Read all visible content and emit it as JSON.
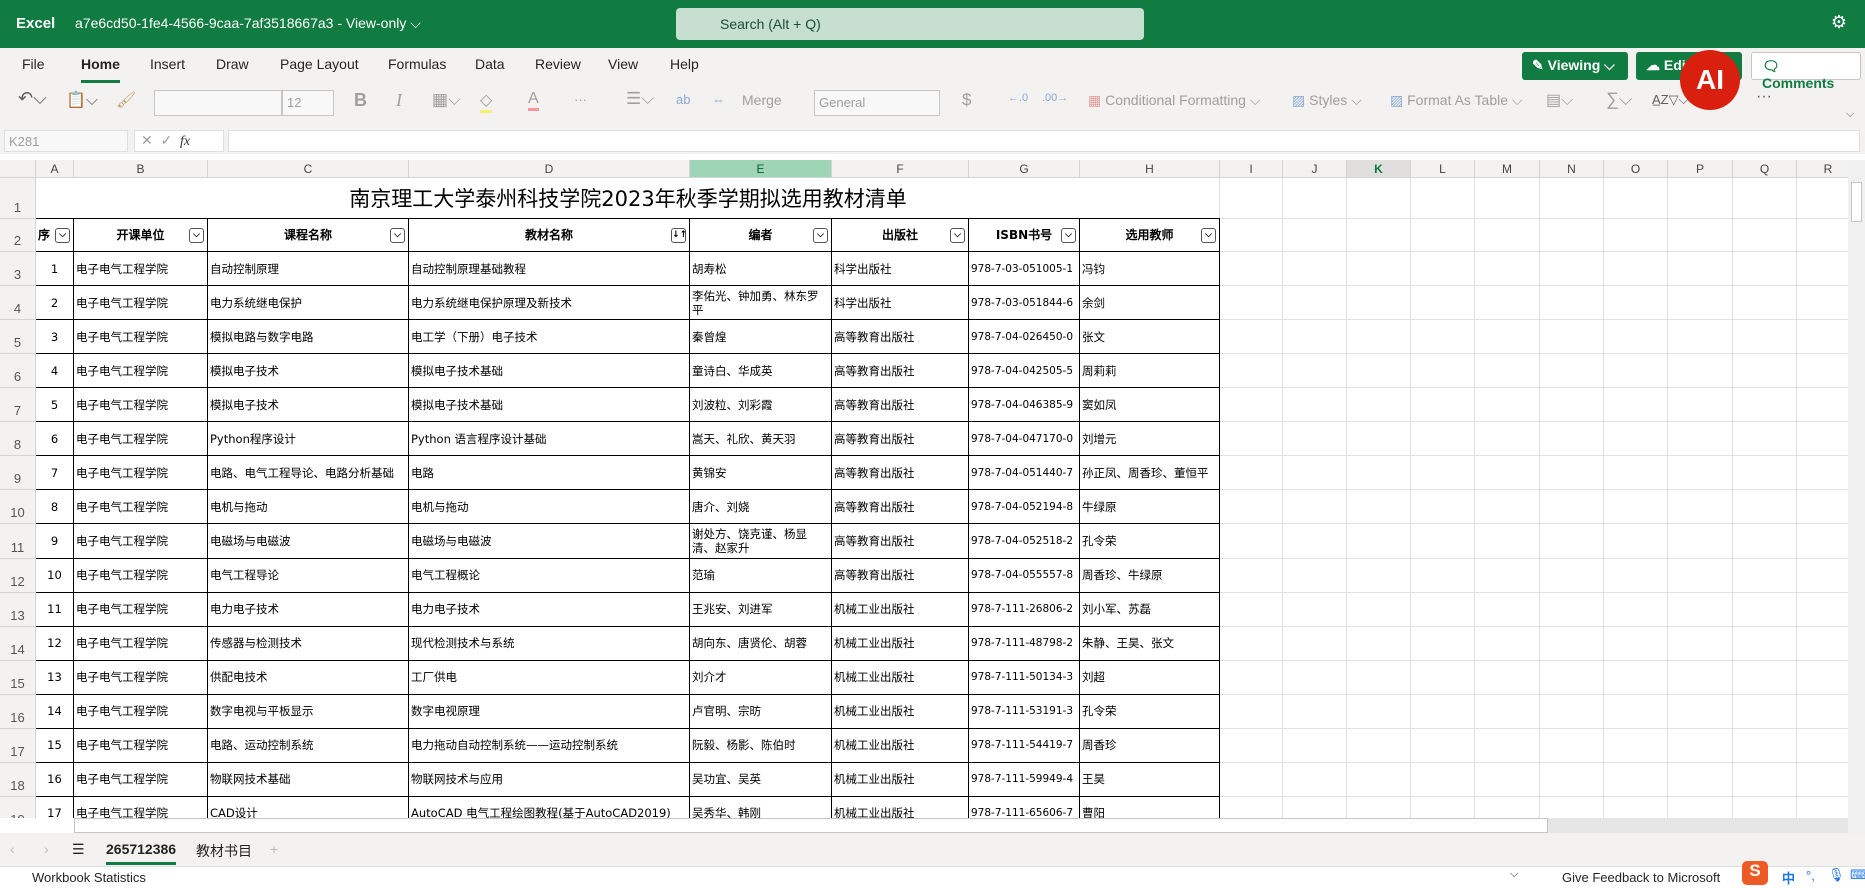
{
  "app": {
    "name": "Excel",
    "doc_title": "a7e6cd50-1fe4-4566-9caa-7af3518667a3",
    "mode": "View-only",
    "search_placeholder": "Search (Alt + Q)"
  },
  "menu": [
    "File",
    "Home",
    "Insert",
    "Draw",
    "Page Layout",
    "Formulas",
    "Data",
    "Review",
    "View",
    "Help"
  ],
  "menu_active": "Home",
  "right_buttons": {
    "viewing": "Viewing",
    "edit": "Edit",
    "comments": "Comments",
    "ai_badge": "AI"
  },
  "toolbar": {
    "font_size": "12",
    "merge": "Merge",
    "number_format": "General",
    "conditional_formatting": "Conditional Formatting",
    "styles": "Styles",
    "format_as_table": "Format As Table",
    "bold": "B",
    "italic": "I",
    "more": "···",
    "currency": "$"
  },
  "formula_bar": {
    "name_box": "K281",
    "fx": "fx",
    "value": ""
  },
  "columns": [
    "A",
    "B",
    "C",
    "D",
    "E",
    "F",
    "G",
    "H",
    "I",
    "J",
    "K",
    "L",
    "M",
    "N",
    "O",
    "P",
    "Q",
    "R"
  ],
  "selected_column": "E",
  "active_column": "K",
  "sheet": {
    "title": "南京理工大学泰州科技学院2023年秋季学期拟选用教材清单",
    "headers": [
      "序",
      "开课单位",
      "课程名称",
      "教材名称",
      "编者",
      "出版社",
      "ISBN书号",
      "选用教师"
    ],
    "rows": [
      [
        "1",
        "电子电气工程学院",
        "自动控制原理",
        "自动控制原理基础教程",
        "胡寿松",
        "科学出版社",
        "978-7-03-051005-1",
        "冯钧"
      ],
      [
        "2",
        "电子电气工程学院",
        "电力系统继电保护",
        "电力系统继电保护原理及新技术",
        "李佑光、钟加勇、林东罗平",
        "科学出版社",
        "978-7-03-051844-6",
        "余剑"
      ],
      [
        "3",
        "电子电气工程学院",
        "模拟电路与数字电路",
        "电工学（下册）电子技术",
        "秦曾煌",
        "高等教育出版社",
        "978-7-04-026450-0",
        "张文"
      ],
      [
        "4",
        "电子电气工程学院",
        "模拟电子技术",
        "模拟电子技术基础",
        "童诗白、华成英",
        "高等教育出版社",
        "978-7-04-042505-5",
        "周莉莉"
      ],
      [
        "5",
        "电子电气工程学院",
        "模拟电子技术",
        "模拟电子技术基础",
        "刘波粒、刘彩霞",
        "高等教育出版社",
        "978-7-04-046385-9",
        "窦如凤"
      ],
      [
        "6",
        "电子电气工程学院",
        "Python程序设计",
        "Python 语言程序设计基础",
        "嵩天、礼欣、黄天羽",
        "高等教育出版社",
        "978-7-04-047170-0",
        "刘增元"
      ],
      [
        "7",
        "电子电气工程学院",
        "电路、电气工程导论、电路分析基础",
        "电路",
        "黄锦安",
        "高等教育出版社",
        "978-7-04-051440-7",
        "孙正凤、周香珍、董恒平"
      ],
      [
        "8",
        "电子电气工程学院",
        "电机与拖动",
        "电机与拖动",
        "唐介、刘娆",
        "高等教育出版社",
        "978-7-04-052194-8",
        "牛绿原"
      ],
      [
        "9",
        "电子电气工程学院",
        "电磁场与电磁波",
        "电磁场与电磁波",
        "谢处方、饶克谨、杨显清、赵家升",
        "高等教育出版社",
        "978-7-04-052518-2",
        "孔令荣"
      ],
      [
        "10",
        "电子电气工程学院",
        "电气工程导论",
        "电气工程概论",
        "范瑜",
        "高等教育出版社",
        "978-7-04-055557-8",
        "周香珍、牛绿原"
      ],
      [
        "11",
        "电子电气工程学院",
        "电力电子技术",
        "电力电子技术",
        "王兆安、刘进军",
        "机械工业出版社",
        "978-7-111-26806-2",
        "刘小军、苏磊"
      ],
      [
        "12",
        "电子电气工程学院",
        "传感器与检测技术",
        "现代检测技术与系统",
        "胡向东、唐贤伦、胡蓉",
        "机械工业出版社",
        "978-7-111-48798-2",
        "朱静、王昊、张文"
      ],
      [
        "13",
        "电子电气工程学院",
        "供配电技术",
        "工厂供电",
        "刘介才",
        "机械工业出版社",
        "978-7-111-50134-3",
        "刘超"
      ],
      [
        "14",
        "电子电气工程学院",
        "数字电视与平板显示",
        "数字电视原理",
        "卢官明、宗昉",
        "机械工业出版社",
        "978-7-111-53191-3",
        "孔令荣"
      ],
      [
        "15",
        "电子电气工程学院",
        "电路、运动控制系统",
        "电力拖动自动控制系统——运动控制系统",
        "阮毅、杨影、陈伯时",
        "机械工业出版社",
        "978-7-111-54419-7",
        "周香珍"
      ],
      [
        "16",
        "电子电气工程学院",
        "物联网技术基础",
        "物联网技术与应用",
        "吴功宜、吴英",
        "机械工业出版社",
        "978-7-111-59949-4",
        "王昊"
      ],
      [
        "17",
        "电子电气工程学院",
        "CAD设计",
        "AutoCAD 电气工程绘图教程(基于AutoCAD2019)",
        "吴秀华、韩刚",
        "机械工业出版社",
        "978-7-111-65606-7",
        "曹阳"
      ]
    ]
  },
  "sheet_tabs": [
    "265712386",
    "教材书目"
  ],
  "active_sheet": "265712386",
  "status": {
    "left": "Workbook Statistics",
    "feedback": "Give Feedback to Microsoft",
    "ime": "中"
  },
  "colors": {
    "brand": "#107c41",
    "ai_badge": "#d9200f"
  }
}
